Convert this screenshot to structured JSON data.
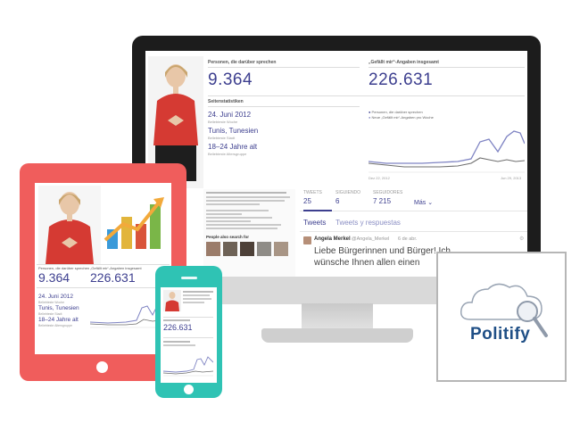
{
  "desktop": {
    "persons_label": "Personen, die darüber sprechen",
    "persons_value": "9.364",
    "likes_label": "„Gefällt mir“-Angaben insgesamt",
    "likes_value": "226.631",
    "page_stats_label": "Seitenstatistiken",
    "stats": [
      {
        "value": "24. Juni 2012",
        "caption": "Beliebteste Woche"
      },
      {
        "value": "Tunis, Tunesien",
        "caption": "Beliebteste Stadt"
      },
      {
        "value": "18–24 Jahre alt",
        "caption": "Beliebteste Altersgruppe"
      }
    ],
    "legend": [
      "Personen, die darüber sprechen",
      "Neue „Gefällt mir“-Angaben pro Woche"
    ],
    "chart_x_start": "Dez 22, 2012",
    "chart_x_end": "Jun 29, 2013",
    "people_also_search": "People also search for",
    "twitter": {
      "tabs": [
        {
          "label": "TWEETS",
          "value": "25"
        },
        {
          "label": "SIGUIENDO",
          "value": "6"
        },
        {
          "label": "SEGUIDORES",
          "value": "7 215"
        }
      ],
      "more": "Más",
      "subtabs": [
        "Tweets",
        "Tweets y respuestas"
      ],
      "author": "Angela Merkel",
      "handle": "@Angela_Merkel",
      "date": "6 de abr.",
      "text": "Liebe Bürgerinnen und Bürger! Ich wünsche Ihnen allen einen"
    }
  },
  "tablet": {
    "persons_label": "Personen, die darüber sprechen",
    "persons_value": "9.364",
    "likes_label": "„Gefällt mir“-Angaben insgesamt",
    "likes_value": "226.631",
    "stats": [
      {
        "value": "24. Juni 2012",
        "caption": "Beliebteste Woche"
      },
      {
        "value": "Tunis, Tunesien",
        "caption": "Beliebteste Stadt"
      },
      {
        "value": "18–24 Jahre alt",
        "caption": "Beliebteste Altersgruppe"
      }
    ]
  },
  "phone": {
    "likes_value": "226.631"
  },
  "logo": {
    "text": "Politify",
    "colors": {
      "text": "#1f4f86",
      "cloud": "#9aa5b4"
    }
  },
  "colors": {
    "tablet": "#f05d5c",
    "phone": "#2fc3b4",
    "accent": "#3d3f8f"
  }
}
